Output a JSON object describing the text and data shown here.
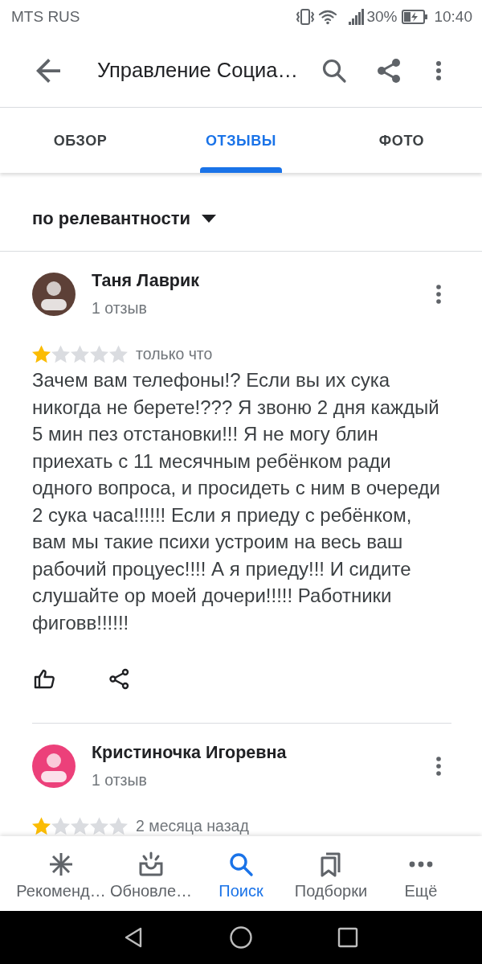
{
  "status_bar": {
    "carrier": "MTS RUS",
    "battery": "30%",
    "time": "10:40"
  },
  "app_bar": {
    "title": "Управление Социа…"
  },
  "tabs": [
    {
      "label": "ОБЗОР",
      "selected": false
    },
    {
      "label": "ОТЗЫВЫ",
      "selected": true
    },
    {
      "label": "ФОТО",
      "selected": false
    }
  ],
  "sort": {
    "label": "по релевантности"
  },
  "reviews": [
    {
      "author": "Таня Лаврик",
      "count": "1 отзыв",
      "color": "#5d4037",
      "stars": 1,
      "time": "только что",
      "text": "Зачем вам телефоны!? Если вы их сука никогда не берете!??? Я звоню 2 дня каждый 5 мин пез отстановки!!! Я не могу блин приехать с 11 месячным ребёнком ради одного вопроса, и просидеть с ним в очереди 2 сука часа!!!!!! Если я приеду с ребёнком, вам мы такие психи устроим на весь ваш рабочий процуес!!!! А я приеду!!! И сидите слушайте ор моей дочери!!!!! Работники фиговв!!!!!!"
    },
    {
      "author": "Кристиночка Игоревна",
      "count": "1 отзыв",
      "color": "#ec407a",
      "stars": 1,
      "time": "2 месяца назад"
    }
  ],
  "bottom_nav": [
    {
      "label": "Рекоменд…",
      "selected": false
    },
    {
      "label": "Обновле…",
      "selected": false
    },
    {
      "label": "Поиск",
      "selected": true
    },
    {
      "label": "Подборки",
      "selected": false
    },
    {
      "label": "Ещё",
      "selected": false
    }
  ]
}
